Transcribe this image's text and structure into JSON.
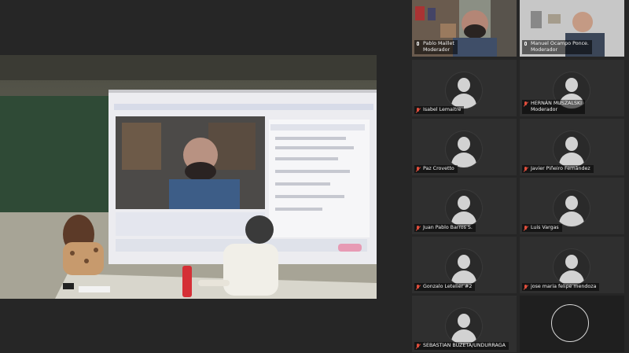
{
  "main_video": {
    "projected_window_label": "Pablo Maillet"
  },
  "participants": [
    {
      "name": "Pablo Maillet",
      "role": "Moderador",
      "video": true,
      "muted": false
    },
    {
      "name": "Manuel Ocampo Ponce.",
      "role": "Moderador",
      "video": true,
      "muted": false
    },
    {
      "name": "Isabel Lemaitre",
      "role": "",
      "video": false,
      "muted": true
    },
    {
      "name": "HERNÁN MUSZALSKI",
      "role": "Moderador",
      "video": false,
      "muted": true
    },
    {
      "name": "Paz Crovetto",
      "role": "",
      "video": false,
      "muted": true
    },
    {
      "name": "Javier Piñeiro Fernández",
      "role": "",
      "video": false,
      "muted": true
    },
    {
      "name": "Juan Pablo Barros S.",
      "role": "",
      "video": false,
      "muted": true
    },
    {
      "name": "Luis Vargas",
      "role": "",
      "video": false,
      "muted": true
    },
    {
      "name": "Gonzalo Letelier #2",
      "role": "",
      "video": false,
      "muted": true
    },
    {
      "name": "jose maria felipe mendoza",
      "role": "",
      "video": false,
      "muted": true
    },
    {
      "name": "SEBASTIAN BUZETA/UNDURRAGA",
      "role": "",
      "video": false,
      "muted": true
    }
  ],
  "colors": {
    "background": "#262626",
    "tile": "#2f2f2f",
    "muted_icon": "#e04e3c"
  }
}
